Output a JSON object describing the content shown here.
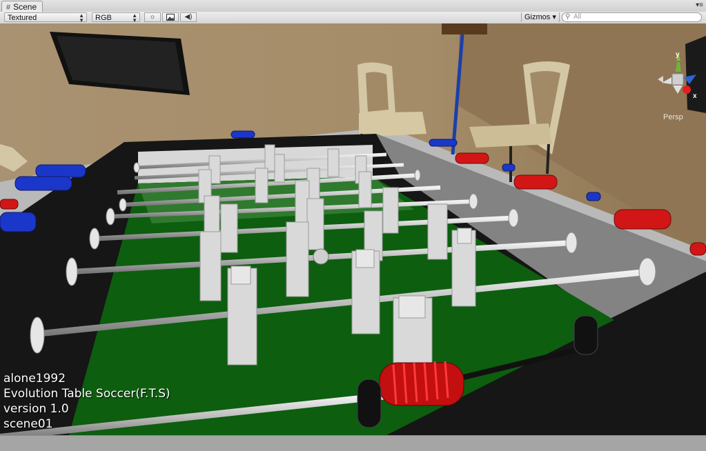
{
  "window": {
    "tab_title": "Scene",
    "tab_icon": "scene-grid-icon"
  },
  "toolbar": {
    "render_mode": "Textured",
    "color_mode": "RGB",
    "buttons": [
      {
        "name": "lighting-toggle",
        "icon": "sun-icon"
      },
      {
        "name": "image-toggle",
        "icon": "image-icon"
      },
      {
        "name": "audio-toggle",
        "icon": "speaker-icon"
      }
    ],
    "gizmos_label": "Gizmos ▾",
    "search_placeholder": "All"
  },
  "scene_gizmo": {
    "projection_label": "Persp",
    "axes": [
      "y",
      "x"
    ]
  },
  "overlay_text": {
    "author": "alone1992",
    "game_title": "Evolution Table Soccer(F.T.S)",
    "version": "version 1.0",
    "scene": "scene01"
  },
  "colors": {
    "wall": "#a88d65",
    "floor": "#b3b3b3",
    "table_frame": "#161616",
    "pitch": "#0d5e0f",
    "rod": "#c6c6c6",
    "player_figure": "#d9d9d9",
    "blue_team_handle": "#1b37c9",
    "red_team_handle": "#d21616"
  }
}
